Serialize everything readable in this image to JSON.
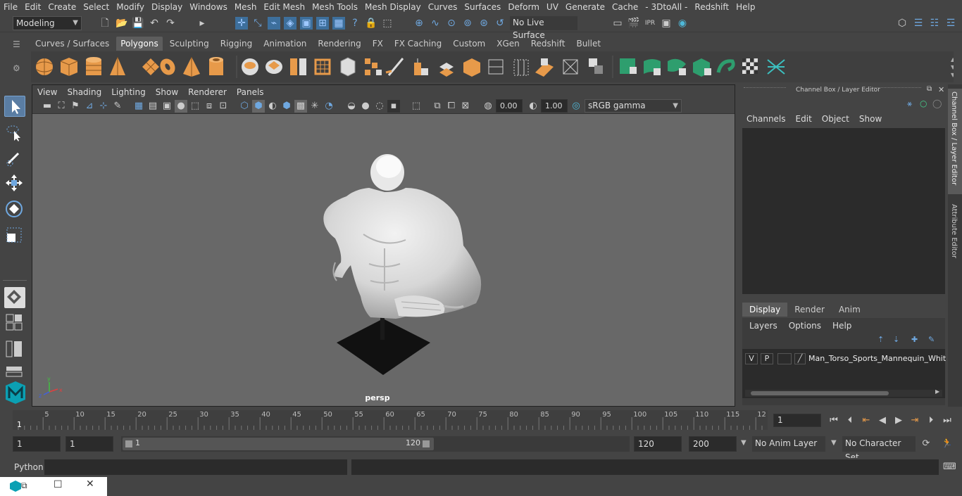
{
  "menubar": {
    "items": [
      "File",
      "Edit",
      "Create",
      "Select",
      "Modify",
      "Display",
      "Windows",
      "Mesh",
      "Edit Mesh",
      "Mesh Tools",
      "Mesh Display",
      "Curves",
      "Surfaces",
      "Deform",
      "UV",
      "Generate",
      "Cache",
      "- 3DtoAll -",
      "Redshift",
      "Help"
    ]
  },
  "status": {
    "workspace": "Modeling",
    "live_surface": "No Live Surface"
  },
  "shelf": {
    "tabs": [
      "Curves / Surfaces",
      "Polygons",
      "Sculpting",
      "Rigging",
      "Animation",
      "Rendering",
      "FX",
      "FX Caching",
      "Custom",
      "XGen",
      "Redshift",
      "Bullet"
    ],
    "active": "Polygons"
  },
  "viewport": {
    "menu": [
      "View",
      "Shading",
      "Lighting",
      "Show",
      "Renderer",
      "Panels"
    ],
    "exposure": "0.00",
    "gamma": "1.00",
    "colorspace": "sRGB gamma",
    "camera": "persp"
  },
  "channelbox": {
    "title": "Channel Box / Layer Editor",
    "menu": [
      "Channels",
      "Edit",
      "Object",
      "Show"
    ],
    "layer_tabs": [
      "Display",
      "Render",
      "Anim"
    ],
    "active_layer_tab": "Display",
    "layer_menu": [
      "Layers",
      "Options",
      "Help"
    ],
    "layer": {
      "v": "V",
      "p": "P",
      "name": "Man_Torso_Sports_Mannequin_Whit"
    }
  },
  "sidetabs": {
    "channel": "Channel Box / Layer Editor",
    "attr": "Attribute Editor"
  },
  "timeline": {
    "ticks": [
      "5",
      "10",
      "15",
      "20",
      "25",
      "30",
      "35",
      "40",
      "45",
      "50",
      "55",
      "60",
      "65",
      "70",
      "75",
      "80",
      "85",
      "90",
      "95",
      "100",
      "105",
      "110",
      "115",
      "12"
    ],
    "start_marker": "1",
    "current_frame": "1"
  },
  "range": {
    "start": "1",
    "playback_start": "1",
    "slider_start": "1",
    "slider_end": "120",
    "playback_end": "120",
    "end": "200",
    "anim_layer": "No Anim Layer",
    "char_set": "No Character Set"
  },
  "cmdline": {
    "label": "Python"
  }
}
